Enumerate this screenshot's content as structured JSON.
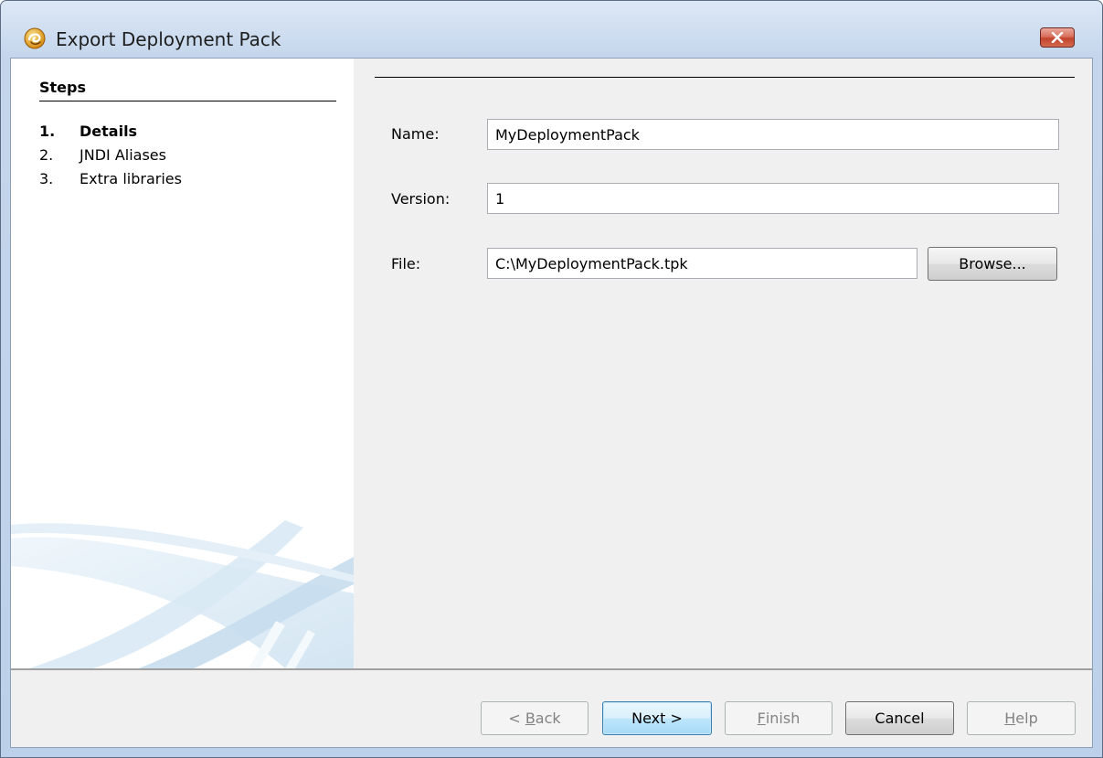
{
  "window": {
    "title": "Export Deployment Pack",
    "close_symbol": "✕"
  },
  "steps": {
    "header": "Steps",
    "items": [
      {
        "num": "1.",
        "label": "Details",
        "active": true
      },
      {
        "num": "2.",
        "label": "JNDI Aliases",
        "active": false
      },
      {
        "num": "3.",
        "label": "Extra libraries",
        "active": false
      }
    ]
  },
  "form": {
    "name_label": "Name:",
    "name_value": "MyDeploymentPack",
    "version_label": "Version:",
    "version_value": "1",
    "file_label": "File:",
    "file_value": "C:\\MyDeploymentPack.tpk",
    "browse_label": "Browse..."
  },
  "buttons": {
    "back": {
      "prefix": "< ",
      "mnemonic": "B",
      "rest": "ack",
      "enabled": false
    },
    "next": {
      "label": "Next >",
      "enabled": true
    },
    "finish": {
      "mnemonic": "F",
      "rest": "inish",
      "enabled": false
    },
    "cancel": {
      "label": "Cancel",
      "enabled": true
    },
    "help": {
      "mnemonic": "H",
      "rest": "elp",
      "enabled": false
    }
  },
  "colors": {
    "titlebar": "#c5d6ec",
    "client_bg": "#f0f0f0",
    "default_button": "#bee6fd",
    "close_button": "#c2432c"
  }
}
